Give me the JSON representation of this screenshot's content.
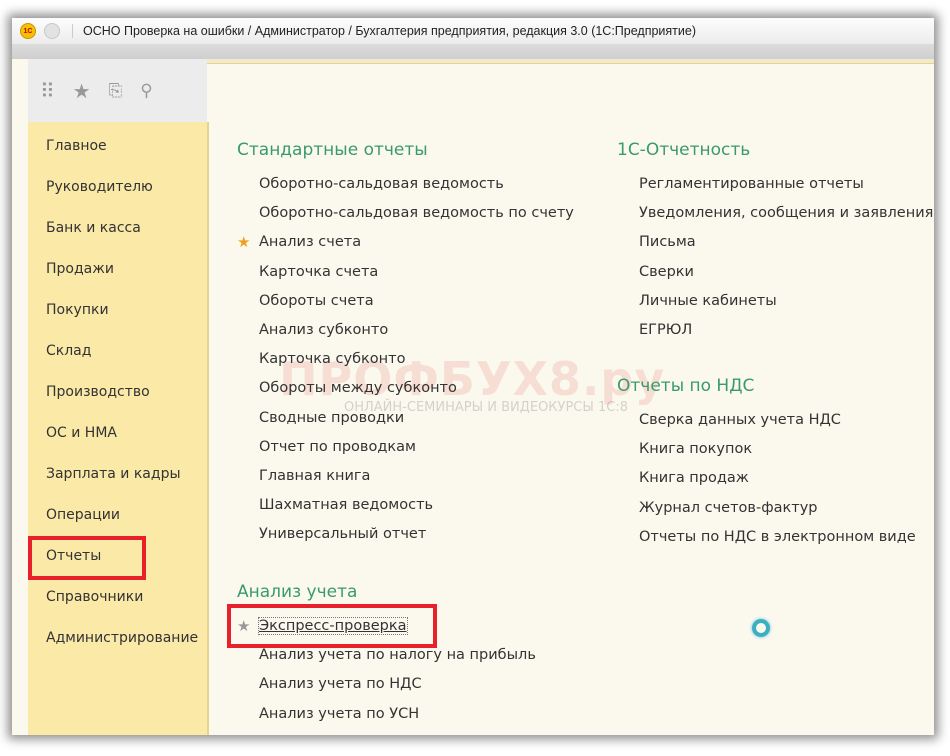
{
  "window": {
    "title": "ОСНО Проверка на ошибки / Администратор / Бухгалтерия предприятия, редакция 3.0  (1С:Предприятие)",
    "logo": "1С"
  },
  "toolbar": {
    "icons": [
      "apps-grid-icon",
      "star-icon",
      "history-icon",
      "search-icon"
    ]
  },
  "sidebar": {
    "items": [
      "Главное",
      "Руководителю",
      "Банк и касса",
      "Продажи",
      "Покупки",
      "Склад",
      "Производство",
      "ОС и НМА",
      "Зарплата и кадры",
      "Операции",
      "Отчеты",
      "Справочники",
      "Администрирование"
    ],
    "selected": "Отчеты"
  },
  "sections": {
    "standard": {
      "title": "Стандартные отчеты",
      "items": [
        "Оборотно-сальдовая ведомость",
        "Оборотно-сальдовая ведомость по счету",
        "Анализ счета",
        "Карточка счета",
        "Обороты счета",
        "Анализ субконто",
        "Карточка субконто",
        "Обороты между субконто",
        "Сводные проводки",
        "Отчет по проводкам",
        "Главная книга",
        "Шахматная ведомость",
        "Универсальный отчет"
      ]
    },
    "analysis": {
      "title": "Анализ учета",
      "items": [
        "Экспресс-проверка",
        "Анализ учета по налогу на прибыль",
        "Анализ учета по НДС",
        "Анализ учета по УСН"
      ]
    },
    "reporting": {
      "title": "1С-Отчетность",
      "items": [
        "Регламентированные отчеты",
        "Уведомления, сообщения и заявления",
        "Письма",
        "Сверки",
        "Личные кабинеты",
        "ЕГРЮЛ"
      ]
    },
    "vat": {
      "title": "Отчеты по НДС",
      "items": [
        "Сверка данных учета НДС",
        "Книга покупок",
        "Книга продаж",
        "Журнал счетов-фактур",
        "Отчеты по НДС в электронном виде"
      ]
    }
  },
  "watermark": {
    "brand": "ПРОФБУХ8.ру",
    "tagline": "ОНЛАЙН-СЕМИНАРЫ И ВИДЕОКУРСЫ 1С:8"
  },
  "colors": {
    "accent": "#3a9a6a",
    "sidebar": "#fbe9a8",
    "highlight": "#e8202a",
    "favorite": "#f0a020"
  }
}
